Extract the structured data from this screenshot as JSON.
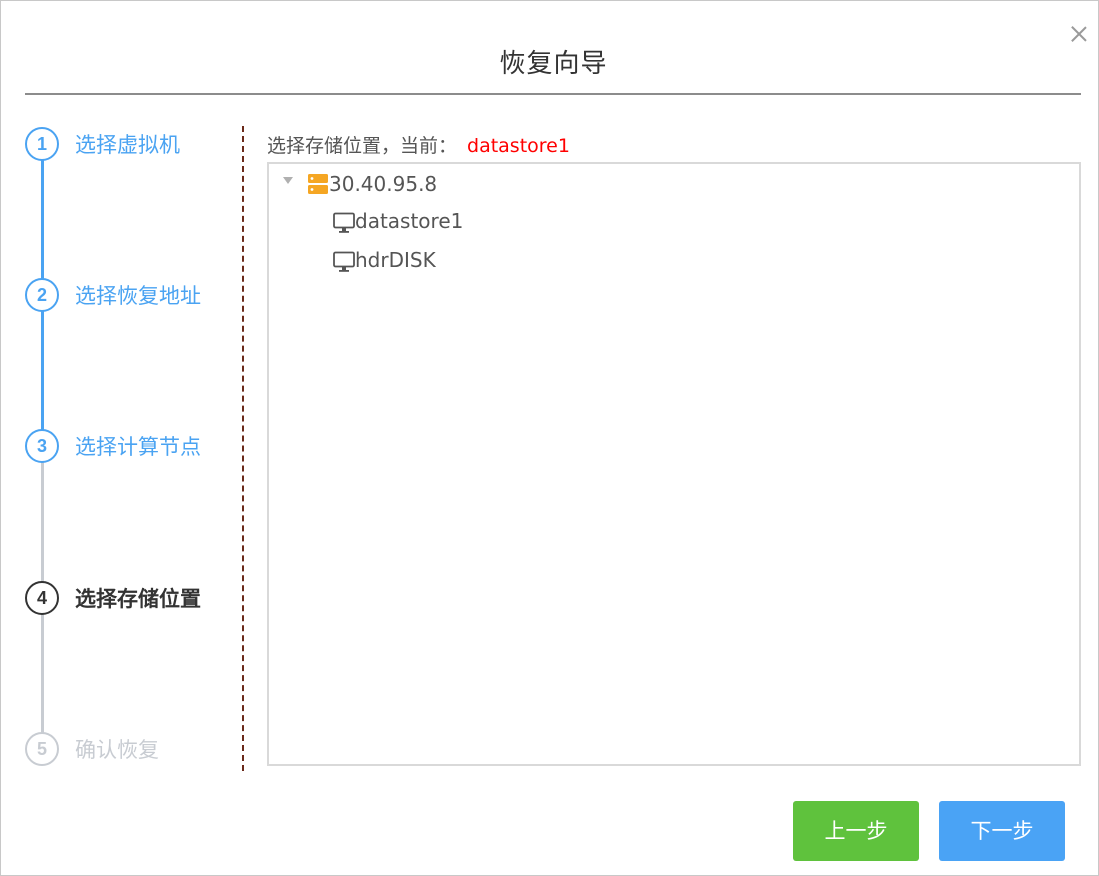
{
  "dialog": {
    "title": "恢复向导",
    "close_icon": "close-icon"
  },
  "steps": [
    {
      "number": "1",
      "label": "选择虚拟机",
      "state": "done"
    },
    {
      "number": "2",
      "label": "选择恢复地址",
      "state": "done"
    },
    {
      "number": "3",
      "label": "选择计算节点",
      "state": "done"
    },
    {
      "number": "4",
      "label": "选择存储位置",
      "state": "active"
    },
    {
      "number": "5",
      "label": "确认恢复",
      "state": "pending"
    }
  ],
  "storage": {
    "caption": "选择存储位置，当前：",
    "current": "datastore1",
    "tree": {
      "host": {
        "label": "30.40.95.8",
        "icon": "server-icon",
        "expanded": true
      },
      "datastores": [
        {
          "label": "datastore1",
          "icon": "monitor-icon"
        },
        {
          "label": "hdrDISK",
          "icon": "monitor-icon"
        }
      ]
    }
  },
  "buttons": {
    "prev_label": "上一步",
    "next_label": "下一步"
  },
  "colors": {
    "step_done": "#4aa3f2",
    "step_active": "#333333",
    "step_pending": "#c8ccd2",
    "current_value": "#ff0000",
    "prev_button": "#5fc23d",
    "next_button": "#4aa3f5",
    "server_icon": "#f5a623"
  }
}
